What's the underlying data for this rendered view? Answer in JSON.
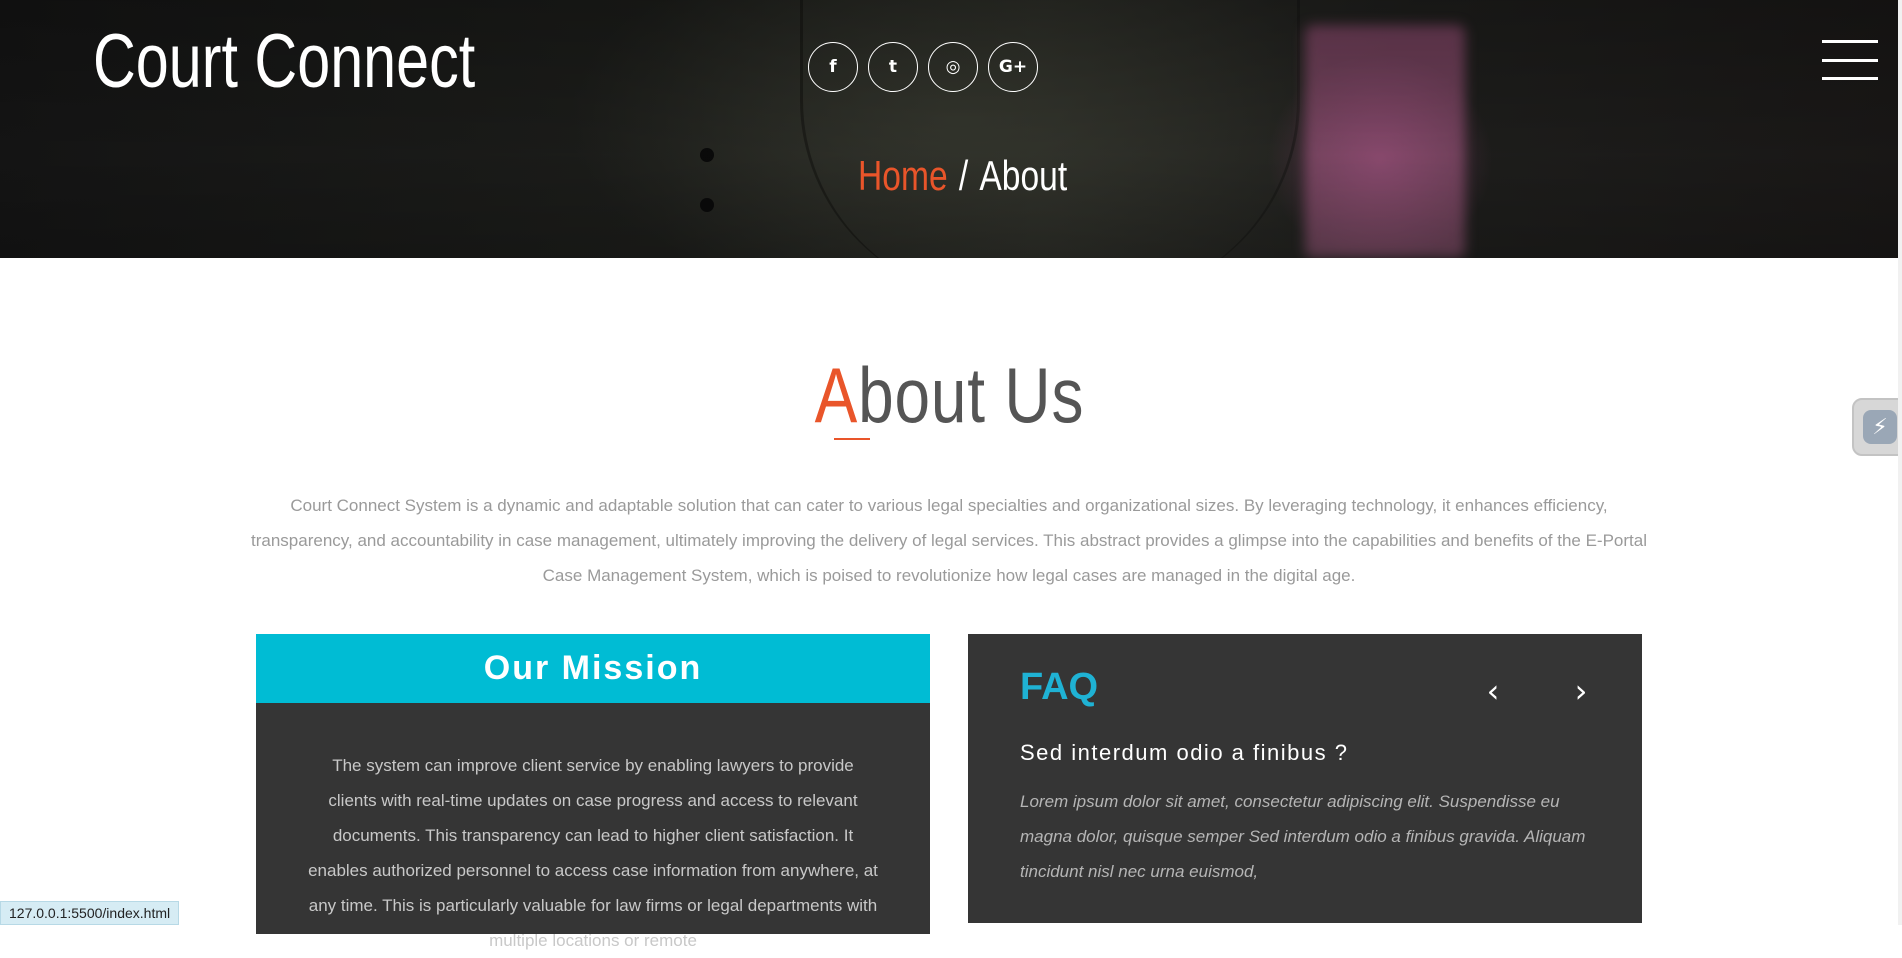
{
  "header": {
    "brand": "Court Connect",
    "socials": [
      {
        "icon": "facebook-icon",
        "glyph": "f"
      },
      {
        "icon": "twitter-icon",
        "glyph": "t"
      },
      {
        "icon": "instagram-icon",
        "glyph": "◎"
      },
      {
        "icon": "google-plus-icon",
        "glyph": "G+"
      }
    ],
    "menu_icon": "hamburger-menu-icon"
  },
  "breadcrumb": {
    "home": "Home",
    "separator": "/",
    "current": "About"
  },
  "about": {
    "title_first": "A",
    "title_rest": "bout Us",
    "text": "Court Connect System is a dynamic and adaptable solution that can cater to various legal specialties and organizational sizes. By leveraging technology, it enhances efficiency, transparency, and accountability in case management, ultimately improving the delivery of legal services. This abstract provides a glimpse into the capabilities and benefits of the E-Portal Case Management System, which is poised to revolutionize how legal cases are managed in the digital age."
  },
  "mission": {
    "title": "Our Mission",
    "text": "The system can improve client service by enabling lawyers to provide clients with real-time updates on case progress and access to relevant documents. This transparency can lead to higher client satisfaction. It enables authorized personnel to access case information from anywhere, at any time. This is particularly valuable for law firms or legal departments with multiple locations or remote"
  },
  "faq": {
    "title": "FAQ",
    "prev_glyph": "‹",
    "next_glyph": "›",
    "question": "Sed interdum odio a finibus ?",
    "answer": "Lorem ipsum dolor sit amet, consectetur adipiscing elit. Suspendisse eu magna dolor, quisque semper Sed interdum odio a finibus gravida. Aliquam tincidunt nisl nec urna euismod,"
  },
  "widget": {
    "icon": "extension-lightning-icon",
    "glyph": "⚡"
  },
  "status": {
    "url": "127.0.0.1:5500/index.html"
  },
  "colors": {
    "accent_orange": "#e9552a",
    "accent_cyan": "#00bcd4",
    "faq_title": "#1fb2d4",
    "card_bg": "#353535"
  }
}
